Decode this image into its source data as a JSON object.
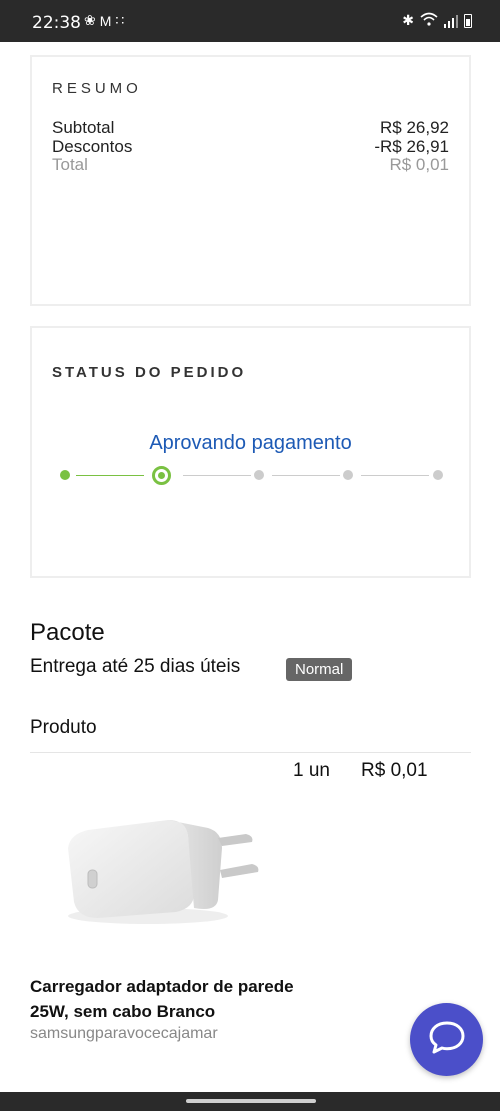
{
  "status_bar": {
    "time": "22:38",
    "icons_left": [
      "facebook-messenger-icon",
      "gmail-icon",
      "notification-icon"
    ],
    "icons_right": [
      "bluetooth-icon",
      "wifi-icon",
      "signal-icon",
      "battery-icon"
    ]
  },
  "resumo": {
    "title": "RESUMO",
    "subtotal_label": "Subtotal",
    "subtotal_value": "R$ 26,92",
    "descontos_label": "Descontos",
    "descontos_value": "-R$ 26,91",
    "total_label": "Total",
    "total_value": "R$ 0,01"
  },
  "status_pedido": {
    "title": "STATUS DO PEDIDO",
    "current_step": "Aprovando pagamento",
    "steps_total": 5,
    "step_index": 2
  },
  "pacote": {
    "title": "Pacote",
    "entrega": "Entrega até 25 dias úteis",
    "badge": "Normal"
  },
  "produto": {
    "title": "Produto",
    "quantity": "1 un",
    "price": "R$ 0,01",
    "name": "Carregador adaptador de parede 25W, sem cabo Branco",
    "seller": "samsungparavocecajamar"
  },
  "colors": {
    "accent_green": "#7ac142",
    "status_blue": "#1d5ab5",
    "chat_purple": "#4b4fc9"
  }
}
